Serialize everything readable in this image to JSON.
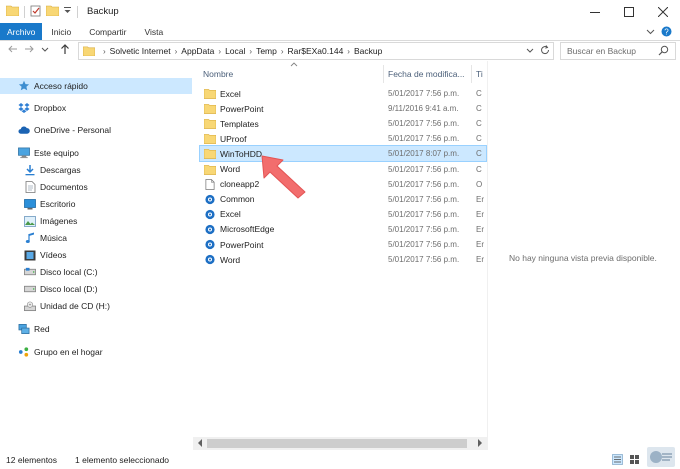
{
  "window": {
    "title": "Backup",
    "controls": [
      "minimize",
      "maximize",
      "close"
    ]
  },
  "ribbon": {
    "tabs": [
      {
        "label": "Archivo",
        "active": true
      },
      {
        "label": "Inicio"
      },
      {
        "label": "Compartir"
      },
      {
        "label": "Vista"
      }
    ]
  },
  "address": {
    "crumbs": [
      "Solvetic Internet",
      "AppData",
      "Local",
      "Temp",
      "Rar$EXa0.144",
      "Backup"
    ]
  },
  "search": {
    "placeholder": "Buscar en Backup"
  },
  "nav": {
    "items": [
      {
        "label": "Acceso rápido",
        "icon": "star-icon",
        "selected": true,
        "indent": 0
      },
      {
        "label": "Dropbox",
        "icon": "dropbox-icon",
        "indent": 0
      },
      {
        "label": "OneDrive - Personal",
        "icon": "cloud-icon",
        "indent": 0
      },
      {
        "label": "Este equipo",
        "icon": "computer-icon",
        "indent": 0
      },
      {
        "label": "Descargas",
        "icon": "download-icon",
        "indent": 1
      },
      {
        "label": "Documentos",
        "icon": "document-icon",
        "indent": 1
      },
      {
        "label": "Escritorio",
        "icon": "desktop-icon",
        "indent": 1
      },
      {
        "label": "Imágenes",
        "icon": "pictures-icon",
        "indent": 1
      },
      {
        "label": "Música",
        "icon": "music-icon",
        "indent": 1
      },
      {
        "label": "Vídeos",
        "icon": "video-icon",
        "indent": 1
      },
      {
        "label": "Disco local (C:)",
        "icon": "drive-icon",
        "indent": 1
      },
      {
        "label": "Disco local (D:)",
        "icon": "drive-icon",
        "indent": 1
      },
      {
        "label": "Unidad de CD (H:)",
        "icon": "cd-drive-icon",
        "indent": 1
      },
      {
        "label": "Red",
        "icon": "network-icon",
        "indent": 0
      },
      {
        "label": "Grupo en el hogar",
        "icon": "homegroup-icon",
        "indent": 0
      }
    ]
  },
  "columns": {
    "name": "Nombre",
    "date": "Fecha de modifica...",
    "type": "Ti"
  },
  "files": [
    {
      "name": "Excel",
      "date": "5/01/2017 7:56 p.m.",
      "type": "C",
      "icon": "folder-icon"
    },
    {
      "name": "PowerPoint",
      "date": "9/11/2016 9:41 a.m.",
      "type": "C",
      "icon": "folder-icon"
    },
    {
      "name": "Templates",
      "date": "5/01/2017 7:56 p.m.",
      "type": "C",
      "icon": "folder-icon"
    },
    {
      "name": "UProof",
      "date": "5/01/2017 7:56 p.m.",
      "type": "C",
      "icon": "folder-icon"
    },
    {
      "name": "WinToHDD",
      "date": "5/01/2017 8:07 p.m.",
      "type": "C",
      "icon": "folder-icon",
      "selected": true
    },
    {
      "name": "Word",
      "date": "5/01/2017 7:56 p.m.",
      "type": "C",
      "icon": "folder-icon"
    },
    {
      "name": "cloneapp2",
      "date": "5/01/2017 7:56 p.m.",
      "type": "O",
      "icon": "file-icon"
    },
    {
      "name": "Common",
      "date": "5/01/2017 7:56 p.m.",
      "type": "Er",
      "icon": "registry-icon"
    },
    {
      "name": "Excel",
      "date": "5/01/2017 7:56 p.m.",
      "type": "Er",
      "icon": "registry-icon"
    },
    {
      "name": "MicrosoftEdge",
      "date": "5/01/2017 7:56 p.m.",
      "type": "Er",
      "icon": "registry-icon"
    },
    {
      "name": "PowerPoint",
      "date": "5/01/2017 7:56 p.m.",
      "type": "Er",
      "icon": "registry-icon"
    },
    {
      "name": "Word",
      "date": "5/01/2017 7:56 p.m.",
      "type": "Er",
      "icon": "registry-icon"
    }
  ],
  "preview": {
    "message": "No hay ninguna vista previa disponible."
  },
  "status": {
    "count": "12 elementos",
    "selection": "1 elemento seleccionado"
  },
  "colors": {
    "accent": "#1979ca",
    "selection": "#cce8ff",
    "selection_border": "#99d1ff",
    "folder": "#f8d775",
    "arrow": "#f26d6d"
  }
}
